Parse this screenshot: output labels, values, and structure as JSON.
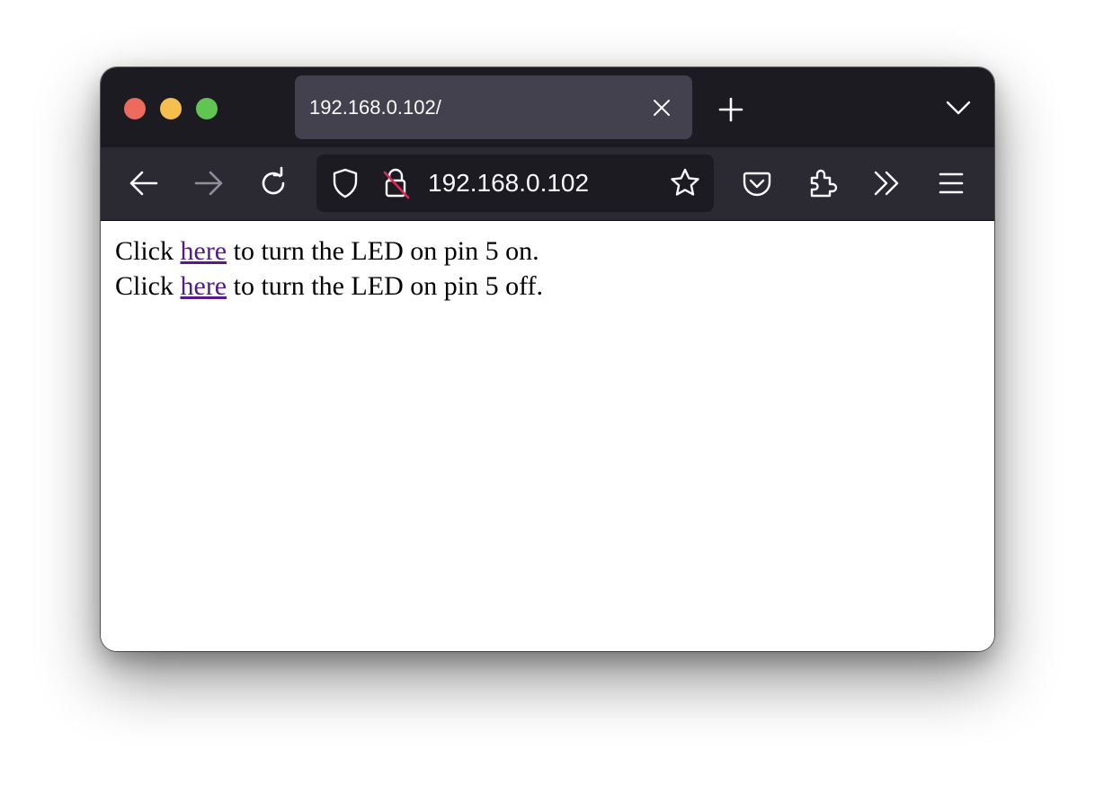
{
  "window": {
    "controls": {
      "close_color": "#ec6a5e",
      "minimize_color": "#f4bf4f",
      "zoom_color": "#61c554"
    }
  },
  "tab": {
    "title": "192.168.0.102/",
    "close_icon": "close-icon",
    "new_tab_icon": "plus-icon",
    "list_all_tabs_icon": "chevron-down-icon"
  },
  "toolbar": {
    "back_icon": "arrow-left-icon",
    "forward_icon": "arrow-right-icon",
    "reload_icon": "reload-icon",
    "url": "192.168.0.102",
    "tracking_protection_icon": "shield-icon",
    "insecure_connection_icon": "unlocked-insecure-icon",
    "bookmark_icon": "star-icon",
    "pocket_icon": "pocket-icon",
    "extensions_icon": "puzzle-icon",
    "overflow_icon": "double-chevron-right-icon",
    "menu_icon": "hamburger-menu-icon"
  },
  "page": {
    "lines": [
      {
        "prefix": "Click ",
        "link": "here",
        "suffix": " to turn the LED on pin 5 on."
      },
      {
        "prefix": "Click ",
        "link": "here",
        "suffix": " to turn the LED on pin 5 off."
      }
    ],
    "link_color": "#551a8b"
  }
}
